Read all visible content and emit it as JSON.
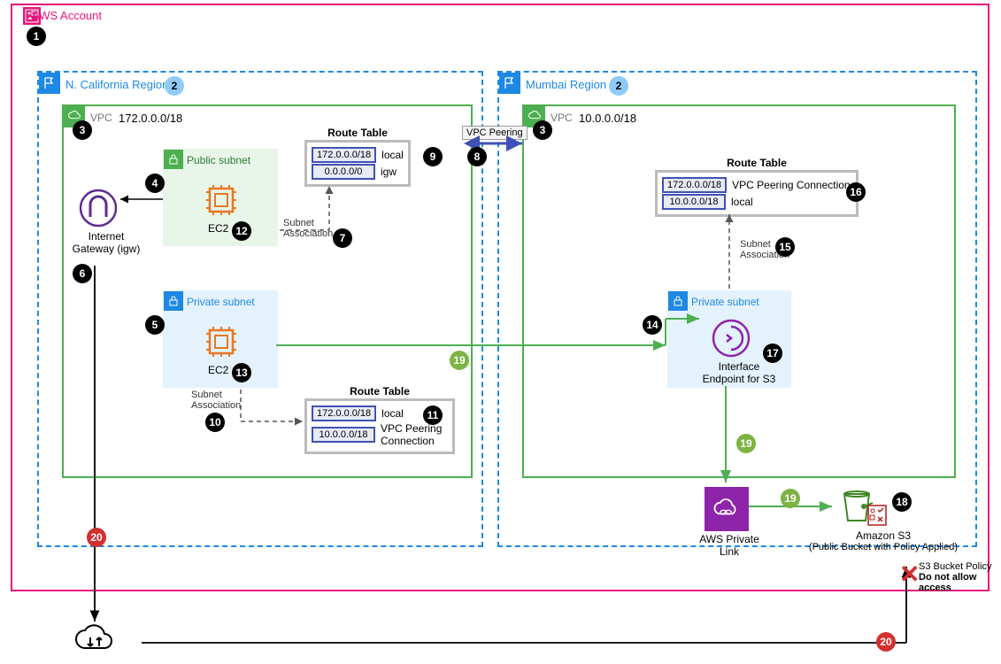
{
  "account": {
    "label": "AWS Account"
  },
  "regions": {
    "left": {
      "label": "N. California Region"
    },
    "right": {
      "label": "Mumbai Region"
    }
  },
  "vpcs": {
    "left": {
      "tag": "VPC",
      "cidr": "172.0.0.0/18"
    },
    "right": {
      "tag": "VPC",
      "cidr": "10.0.0.0/18"
    }
  },
  "subnets": {
    "left_public": {
      "label": "Public subnet"
    },
    "left_private": {
      "label": "Private subnet"
    },
    "right_private": {
      "label": "Private subnet"
    }
  },
  "components": {
    "igw_label_line1": "Internet",
    "igw_label_line2": "Gateway (igw)",
    "ec2_label": "EC2",
    "endpoint_label_line1": "Interface",
    "endpoint_label_line2": "Endpoint for S3",
    "privatelink_label_line1": "AWS Private",
    "privatelink_label_line2": "Link",
    "s3_label_line1": "Amazon S3",
    "s3_label_line2": "(Public Bucket with Policy Applied)",
    "bucket_policy_line1": "S3 Bucket Policy",
    "bucket_policy_line2": "Do not allow access"
  },
  "route_tables": {
    "rt_public": {
      "title": "Route Table",
      "rows": [
        {
          "cidr": "172.0.0.0/18",
          "target": "local"
        },
        {
          "cidr": "0.0.0.0/0",
          "target": "igw"
        }
      ]
    },
    "rt_left_private": {
      "title": "Route Table",
      "rows": [
        {
          "cidr": "172.0.0.0/18",
          "target": "local"
        },
        {
          "cidr": "10.0.0.0/18",
          "target": "VPC Peering"
        }
      ],
      "target2_line2": "Connection"
    },
    "rt_right": {
      "title": "Route Table",
      "rows": [
        {
          "cidr": "172.0.0.0/18",
          "target": "VPC Peering Connection"
        },
        {
          "cidr": "10.0.0.0/18",
          "target": "local"
        }
      ]
    }
  },
  "peering_label": "VPC Peering",
  "assoc_label": {
    "line1": "Subnet",
    "line2": "Association"
  },
  "badges": {
    "b1": "1",
    "b2a": "2",
    "b2b": "2",
    "b3a": "3",
    "b3b": "3",
    "b4": "4",
    "b5": "5",
    "b6": "6",
    "b7": "7",
    "b8": "8",
    "b9": "9",
    "b10": "10",
    "b11": "11",
    "b12": "12",
    "b13": "13",
    "b14": "14",
    "b15": "15",
    "b16": "16",
    "b17": "17",
    "b18": "18",
    "b19a": "19",
    "b19b": "19",
    "b19c": "19",
    "b20a": "20",
    "b20b": "20"
  }
}
